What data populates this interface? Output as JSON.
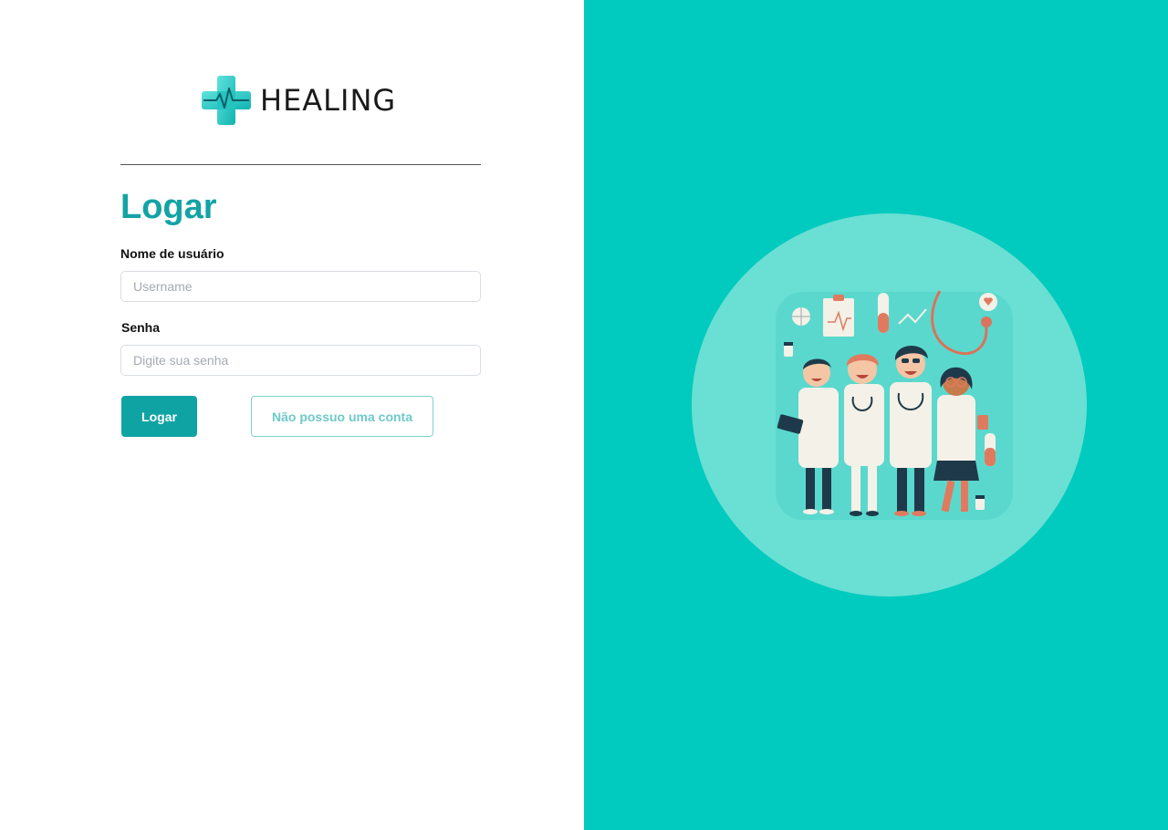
{
  "brand": {
    "name": "HEALING",
    "logo_icon": "medical-cross-heartbeat-icon"
  },
  "login": {
    "title": "Logar",
    "username_label": "Nome de usuário",
    "username_placeholder": "Username",
    "password_label": "Senha",
    "password_placeholder": "Digite sua senha",
    "submit_label": "Logar",
    "register_label": "Não possuo uma conta"
  },
  "theme": {
    "accent": "#14a3a5",
    "panel_background": "#00cbbe",
    "circle_background": "#6adfd4"
  },
  "illustration": {
    "subject": "medical-team-illustration"
  }
}
